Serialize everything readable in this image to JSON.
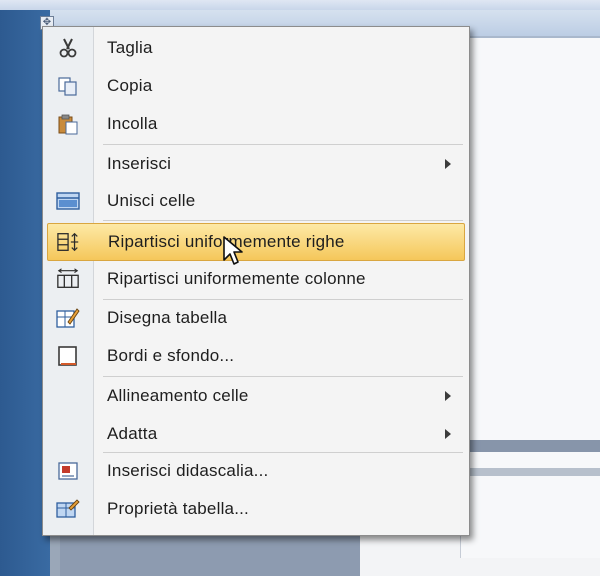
{
  "menu": {
    "items": [
      {
        "label": "Taglia",
        "icon": "scissors-icon",
        "submenu": false
      },
      {
        "label": "Copia",
        "icon": "copy-icon",
        "submenu": false
      },
      {
        "label": "Incolla",
        "icon": "paste-icon",
        "submenu": false
      },
      {
        "label": "Inserisci",
        "icon": "",
        "submenu": true
      },
      {
        "label": "Unisci celle",
        "icon": "merge-cells-icon",
        "submenu": false
      },
      {
        "label": "Ripartisci uniformemente righe",
        "icon": "distribute-rows-icon",
        "submenu": false,
        "highlighted": true
      },
      {
        "label": "Ripartisci uniformemente colonne",
        "icon": "distribute-columns-icon",
        "submenu": false
      },
      {
        "label": "Disegna tabella",
        "icon": "draw-table-icon",
        "submenu": false
      },
      {
        "label": "Bordi e sfondo...",
        "icon": "borders-shading-icon",
        "submenu": false
      },
      {
        "label": "Allineamento celle",
        "icon": "",
        "submenu": true
      },
      {
        "label": "Adatta",
        "icon": "",
        "submenu": true
      },
      {
        "label": "Inserisci didascalia...",
        "icon": "insert-caption-icon",
        "submenu": false
      },
      {
        "label": "Proprietà tabella...",
        "icon": "table-properties-icon",
        "submenu": false
      }
    ]
  },
  "colors": {
    "highlight": "#f5c75a",
    "menu_bg": "#f4f4f4",
    "desktop_blue": "#2f5d93"
  }
}
